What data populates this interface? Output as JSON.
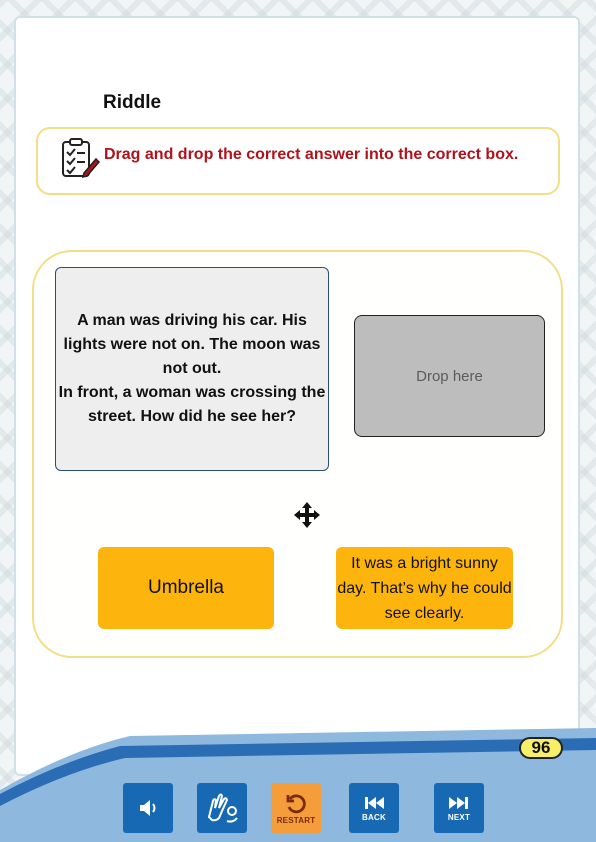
{
  "activity": {
    "title": "Riddle",
    "instruction": "Drag and drop the correct answer into the correct box.",
    "riddle": "A man was driving his car. His lights were not on. The moon was not out.\nIn front, a woman was crossing the street. How did he see her?",
    "drop_placeholder": "Drop here",
    "answers": [
      {
        "label": "Umbrella"
      },
      {
        "label": "It was a bright sunny day. That’s why he could see clearly."
      }
    ]
  },
  "footer": {
    "page_number": "96",
    "buttons": {
      "audio_icon": "speaker-icon",
      "sign_language_icon": "sign-language-icon",
      "restart_label": "RESTART",
      "back_label": "BACK",
      "next_label": "NEXT"
    }
  },
  "colors": {
    "accent_yellow": "#fdb50e",
    "instruction_red": "#b0121b",
    "toolbar_blue": "#1769b4",
    "restart_orange": "#f59d3a"
  }
}
